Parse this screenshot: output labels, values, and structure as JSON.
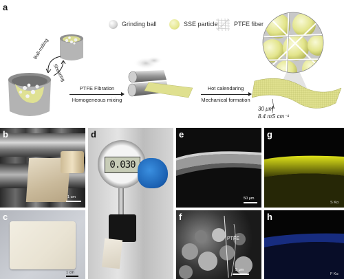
{
  "panel_labels": {
    "a": "a",
    "b": "b",
    "c": "c",
    "d": "d",
    "e": "e",
    "f": "f",
    "g": "g",
    "h": "h"
  },
  "legend": {
    "grinding_ball": "Grinding ball",
    "sse_particle": "SSE particle",
    "ptfe_fiber": "PTFE fiber"
  },
  "process": {
    "ball_milling": "Ball-milling",
    "shearing": "Shearing",
    "step1_top": "PTFE Fibration",
    "step1_bottom": "Homogeneous mixing",
    "step2_top": "Hot calendaring",
    "step2_bottom": "Mechanical formation"
  },
  "film_specs": {
    "thickness": "30 μm",
    "conductivity": "8.4 mS cm⁻¹"
  },
  "gauge_reading": "0.030",
  "scale_bars": {
    "b": "1 cm",
    "c": "1 cm",
    "e": "50 μm",
    "f": "5 μm"
  },
  "annotations": {
    "ptfe_label": "PTFE",
    "g_element": "S Kα",
    "h_element": "F Kα"
  },
  "colors": {
    "sse_yellow": "#e8eb9c",
    "film_yellow": "#d7d98a",
    "eds_yellow": "#d9dc1e",
    "eds_blue": "#1f3fbf",
    "gray_container": "#b9b9b9"
  }
}
